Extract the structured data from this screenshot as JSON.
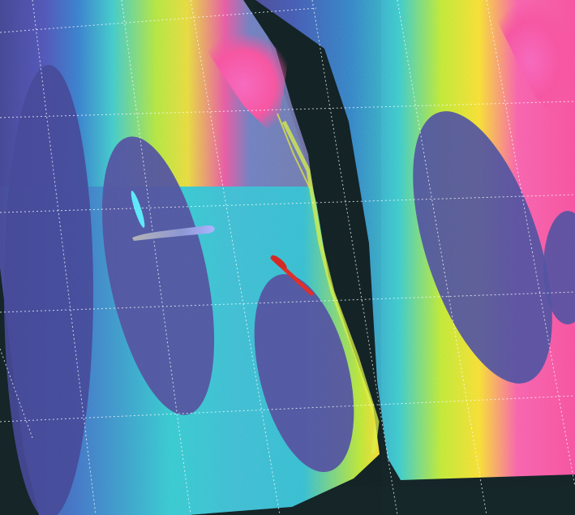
{
  "viewer": {
    "background_color": "#16272a",
    "grid_color": "#ffffff",
    "colormap": [
      "#4b4f9e",
      "#5a5cc4",
      "#3f88d6",
      "#35c9d8",
      "#52e0c0",
      "#c6f23a",
      "#ffe63a",
      "#ff9a3a",
      "#ff5aa8",
      "#ff70c4"
    ],
    "markers": [
      {
        "name": "cyan-arrow",
        "color": "#5ff1ff"
      },
      {
        "name": "gray-arrow",
        "color": "#9aa3c8"
      },
      {
        "name": "red-arrow",
        "color": "#e0302a"
      }
    ]
  }
}
